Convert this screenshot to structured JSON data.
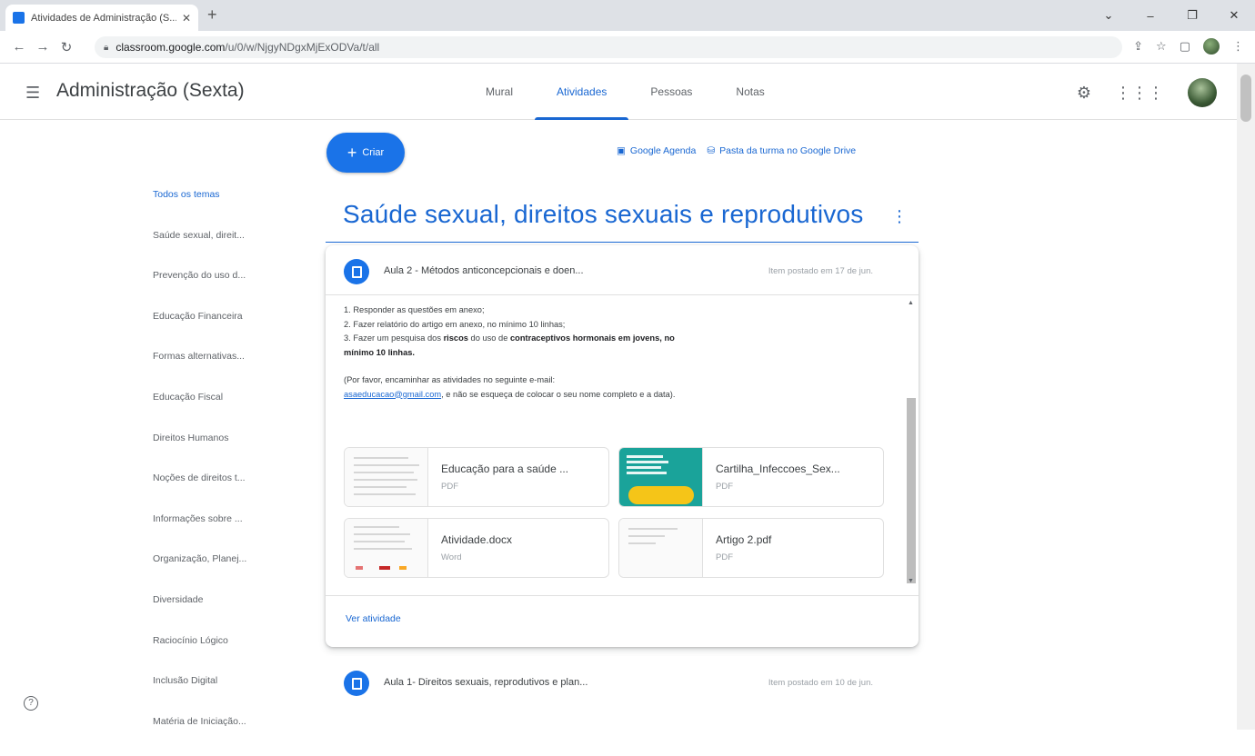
{
  "browser": {
    "tab_title": "Atividades de Administração (S...",
    "url_host": "classroom.google.com",
    "url_path": "/u/0/w/NjgyNDgxMjExODVa/t/all"
  },
  "header": {
    "class_name": "Administração (Sexta)",
    "tabs": [
      {
        "label": "Mural"
      },
      {
        "label": "Atividades"
      },
      {
        "label": "Pessoas"
      },
      {
        "label": "Notas"
      }
    ]
  },
  "actions": {
    "create_label": "Criar",
    "calendar_label": "Google Agenda",
    "drive_label": "Pasta da turma no Google Drive"
  },
  "topics": [
    "Todos os temas",
    "Saúde sexual, direit...",
    "Prevenção do uso d...",
    "Educação Financeira",
    "Formas alternativas...",
    "Educação Fiscal",
    "Direitos Humanos",
    "Noções de direitos t...",
    "Informações sobre ...",
    "Organização, Planej...",
    "Diversidade",
    "Raciocínio Lógico",
    "Inclusão Digital",
    "Matéria de Iniciação..."
  ],
  "topic": {
    "title": "Saúde sexual, direitos sexuais e reprodutivos"
  },
  "assignment": {
    "title": "Aula 2 - Métodos anticoncepcionais e doen...",
    "date": "Item postado em 17 de jun.",
    "desc_1": "1. Responder as questões em anexo;",
    "desc_2": "2. Fazer relatório do artigo em anexo, no mínimo 10 linhas;",
    "desc_3a": "3. Fazer um pesquisa dos ",
    "desc_3b": "riscos",
    "desc_3c": " do uso de ",
    "desc_3d": "contraceptivos hormonais em jovens, no mínimo 10 linhas.",
    "desc_4a": "(Por favor, encaminhar as atividades no seguinte e-mail:",
    "desc_4b": "asaeducacao@gmail.com",
    "desc_4c": ", e não se esqueça de colocar o seu nome completo e a data).",
    "attachments": [
      {
        "name": "Educação para a saúde ...",
        "type": "PDF"
      },
      {
        "name": "Cartilha_Infeccoes_Sex...",
        "type": "PDF"
      },
      {
        "name": "Atividade.docx",
        "type": "Word"
      },
      {
        "name": "Artigo 2.pdf",
        "type": "PDF"
      }
    ],
    "view_label": "Ver atividade"
  },
  "assignment2": {
    "title": "Aula 1- Direitos sexuais, reprodutivos e plan...",
    "date": "Item postado em 10 de jun."
  },
  "colors": {
    "accent": "#1967d2",
    "create_button": "#1a73e8",
    "pdf_thumb_teal": "#1aa39a"
  }
}
